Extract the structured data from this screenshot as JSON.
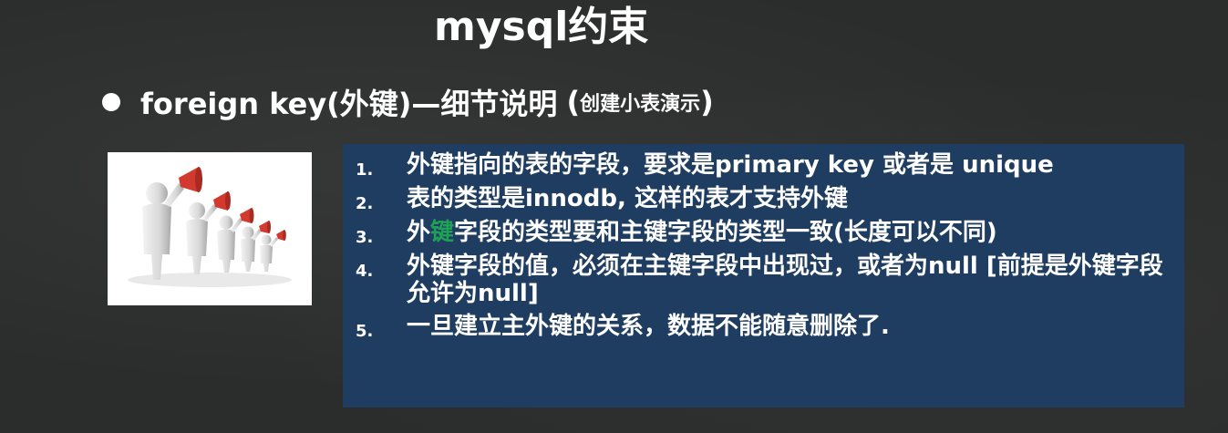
{
  "slide": {
    "title": "mysql约束",
    "subtitle": {
      "main": "foreign key(外键)—细节说明",
      "paren_open": "(",
      "note": "创建小表演示",
      "paren_close": ")"
    },
    "image": {
      "icon": "megaphone-people-icon"
    },
    "list": [
      {
        "num": "1.",
        "text": "外键指向的表的字段，要求是primary key 或者是 unique"
      },
      {
        "num": "2.",
        "text": "表的类型是innodb, 这样的表才支持外键"
      },
      {
        "num": "3.",
        "text_a": "外",
        "text_b": "键",
        "text_c": "字段的类型要和主键字段的类型一致(长度可以不同)"
      },
      {
        "num": "4.",
        "text": "外键字段的值，必须在主键字段中出现过，或者为null [前提是外键字段允许为null]"
      },
      {
        "num": "5.",
        "text": "一旦建立主外键的关系，数据不能随意删除了."
      }
    ],
    "colors": {
      "background": "#2b2c2c",
      "panel": "#1f3d60",
      "text": "#ffffff",
      "highlight": "#1f9f57",
      "megaphone": "#d23a2f"
    }
  }
}
